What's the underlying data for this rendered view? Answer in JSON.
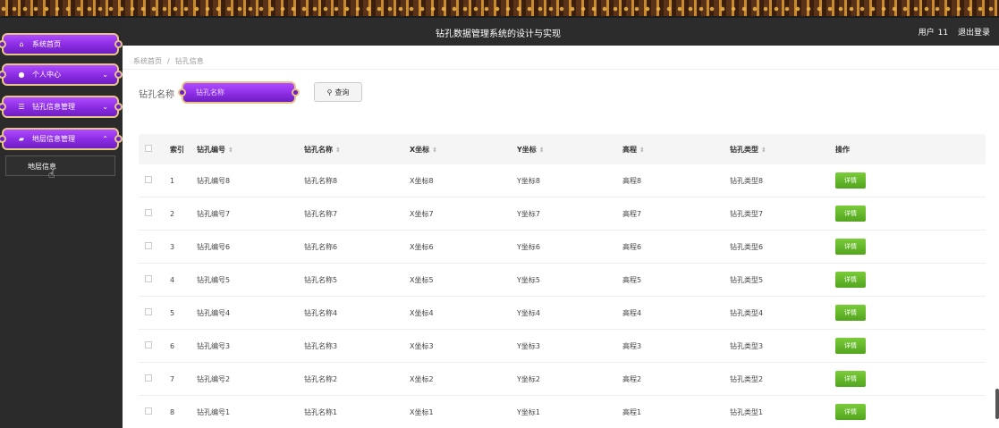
{
  "app": {
    "title": "钻孔数据管理系统的设计与实现"
  },
  "user": {
    "label": "用户",
    "name": "11",
    "logout": "退出登录"
  },
  "sidebar": {
    "items": [
      {
        "label": "系统首页",
        "icon": "home-icon",
        "expandable": false
      },
      {
        "label": "个人中心",
        "icon": "user-icon",
        "expandable": true
      },
      {
        "label": "钻孔信息管理",
        "icon": "list-icon",
        "expandable": true
      },
      {
        "label": "地层信息管理",
        "icon": "layers-icon",
        "expandable": true,
        "expanded": true
      }
    ],
    "submenu": {
      "label": "地层信息"
    }
  },
  "breadcrumb": {
    "home": "系统首页",
    "separator": "/",
    "current": "钻孔信息"
  },
  "search": {
    "label": "钻孔名称",
    "placeholder": "钻孔名称",
    "button": "查询"
  },
  "table": {
    "headers": [
      "索引",
      "钻孔编号",
      "钻孔名称",
      "X坐标",
      "Y坐标",
      "高程",
      "钻孔类型",
      "操作"
    ],
    "action_label": "详情",
    "rows": [
      [
        "1",
        "钻孔编号8",
        "钻孔名称8",
        "X坐标8",
        "Y坐标8",
        "高程8",
        "钻孔类型8"
      ],
      [
        "2",
        "钻孔编号7",
        "钻孔名称7",
        "X坐标7",
        "Y坐标7",
        "高程7",
        "钻孔类型7"
      ],
      [
        "3",
        "钻孔编号6",
        "钻孔名称6",
        "X坐标6",
        "Y坐标6",
        "高程6",
        "钻孔类型6"
      ],
      [
        "4",
        "钻孔编号5",
        "钻孔名称5",
        "X坐标5",
        "Y坐标5",
        "高程5",
        "钻孔类型5"
      ],
      [
        "5",
        "钻孔编号4",
        "钻孔名称4",
        "X坐标4",
        "Y坐标4",
        "高程4",
        "钻孔类型4"
      ],
      [
        "6",
        "钻孔编号3",
        "钻孔名称3",
        "X坐标3",
        "Y坐标3",
        "高程3",
        "钻孔类型3"
      ],
      [
        "7",
        "钻孔编号2",
        "钻孔名称2",
        "X坐标2",
        "Y坐标2",
        "高程2",
        "钻孔类型2"
      ],
      [
        "8",
        "钻孔编号1",
        "钻孔名称1",
        "X坐标1",
        "Y坐标1",
        "高程1",
        "钻孔类型1"
      ]
    ]
  },
  "colors": {
    "accent": "#8a2be2",
    "gold": "#e7c48a",
    "success": "#5cb52a",
    "chrome": "#2b2b2b"
  }
}
